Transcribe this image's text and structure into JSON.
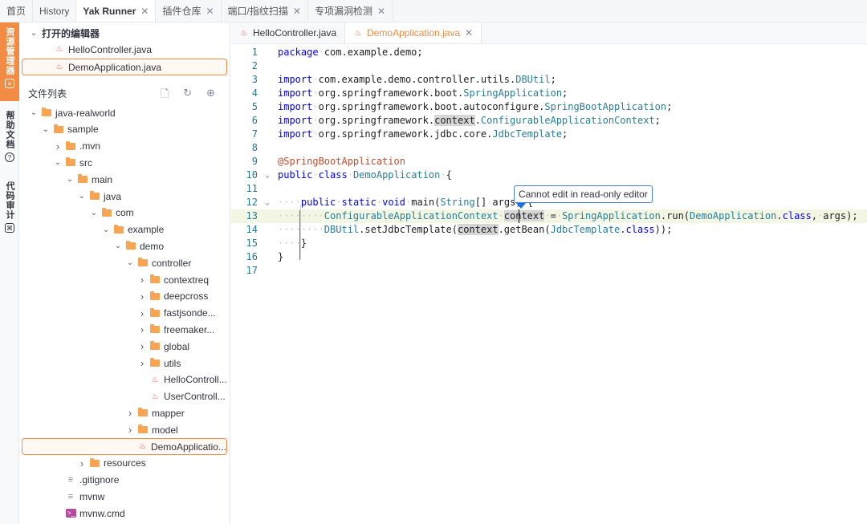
{
  "top_tabs": [
    {
      "label": "首页"
    },
    {
      "label": "History"
    },
    {
      "label": "Yak Runner",
      "closable": true,
      "active": true
    },
    {
      "label": "插件仓库",
      "closable": true
    },
    {
      "label": "端口/指纹扫描",
      "closable": true
    },
    {
      "label": "专项漏洞检测",
      "closable": true
    }
  ],
  "left_strip": {
    "resource_manager": "资源管理器",
    "help_docs": "帮助文档",
    "code_audit": "代码审计"
  },
  "sidebar": {
    "open_editors_title": "打开的编辑器",
    "open_editors": [
      "HelloController.java",
      "DemoApplication.java"
    ],
    "file_list_title": "文件列表",
    "tree": [
      {
        "label": "java-realworld",
        "kind": "folder",
        "depth": 0,
        "expanded": true
      },
      {
        "label": "sample",
        "kind": "folder",
        "depth": 1,
        "expanded": true
      },
      {
        "label": ".mvn",
        "kind": "folder",
        "depth": 2,
        "expanded": false
      },
      {
        "label": "src",
        "kind": "folder",
        "depth": 2,
        "expanded": true
      },
      {
        "label": "main",
        "kind": "folder",
        "depth": 3,
        "expanded": true
      },
      {
        "label": "java",
        "kind": "folder",
        "depth": 4,
        "expanded": true
      },
      {
        "label": "com",
        "kind": "folder",
        "depth": 5,
        "expanded": true
      },
      {
        "label": "example",
        "kind": "folder",
        "depth": 6,
        "expanded": true
      },
      {
        "label": "demo",
        "kind": "folder",
        "depth": 7,
        "expanded": true
      },
      {
        "label": "controller",
        "kind": "folder",
        "depth": 8,
        "expanded": true
      },
      {
        "label": "contextreq",
        "kind": "folder",
        "depth": 9,
        "expanded": false
      },
      {
        "label": "deepcross",
        "kind": "folder",
        "depth": 9,
        "expanded": false
      },
      {
        "label": "fastjsonde...",
        "kind": "folder",
        "depth": 9,
        "expanded": false
      },
      {
        "label": "freemaker...",
        "kind": "folder",
        "depth": 9,
        "expanded": false
      },
      {
        "label": "global",
        "kind": "folder",
        "depth": 9,
        "expanded": false
      },
      {
        "label": "utils",
        "kind": "folder",
        "depth": 9,
        "expanded": false
      },
      {
        "label": "HelloControll...",
        "kind": "java",
        "depth": 9
      },
      {
        "label": "UserControll...",
        "kind": "java",
        "depth": 9
      },
      {
        "label": "mapper",
        "kind": "folder",
        "depth": 8,
        "expanded": false
      },
      {
        "label": "model",
        "kind": "folder",
        "depth": 8,
        "expanded": false
      },
      {
        "label": "DemoApplicatio...",
        "kind": "java",
        "depth": 8,
        "selected": true
      },
      {
        "label": "resources",
        "kind": "folder",
        "depth": 4,
        "expanded": false
      },
      {
        "label": ".gitignore",
        "kind": "file",
        "depth": 2
      },
      {
        "label": "mvnw",
        "kind": "file",
        "depth": 2
      },
      {
        "label": "mvnw.cmd",
        "kind": "cmd",
        "depth": 2
      }
    ]
  },
  "editor": {
    "tabs": [
      {
        "label": "HelloController.java",
        "active": false
      },
      {
        "label": "DemoApplication.java",
        "active": true,
        "closable": true
      }
    ],
    "tooltip": "Cannot edit in read-only editor",
    "highlight_line": 13,
    "lines": [
      {
        "n": "1",
        "code": "package com.example.demo;"
      },
      {
        "n": "2",
        "code": ""
      },
      {
        "n": "3",
        "code": "import com.example.demo.controller.utils.DBUtil;"
      },
      {
        "n": "4",
        "code": "import org.springframework.boot.SpringApplication;"
      },
      {
        "n": "5",
        "code": "import org.springframework.boot.autoconfigure.SpringBootApplication;"
      },
      {
        "n": "6",
        "code": "import org.springframework.context.ConfigurableApplicationContext;"
      },
      {
        "n": "7",
        "code": "import org.springframework.jdbc.core.JdbcTemplate;"
      },
      {
        "n": "8",
        "code": ""
      },
      {
        "n": "9",
        "code": "@SpringBootApplication"
      },
      {
        "n": "10",
        "code": "public class DemoApplication {"
      },
      {
        "n": "11",
        "code": ""
      },
      {
        "n": "12",
        "code": "    public static void main(String[] args) {"
      },
      {
        "n": "13",
        "code": "        ConfigurableApplicationContext context = SpringApplication.run(DemoApplication.class, args);"
      },
      {
        "n": "14",
        "code": "        DBUtil.setJdbcTemplate(context.getBean(JdbcTemplate.class));"
      },
      {
        "n": "15",
        "code": "    }"
      },
      {
        "n": "16",
        "code": "}"
      },
      {
        "n": "17",
        "code": ""
      }
    ]
  },
  "colors": {
    "accent": "#f28b44",
    "keyword": "#0000ff",
    "type": "#267f99",
    "annotation": "#c04d2e",
    "line_number": "#237893",
    "tooltip_border": "#3f7fe0"
  }
}
